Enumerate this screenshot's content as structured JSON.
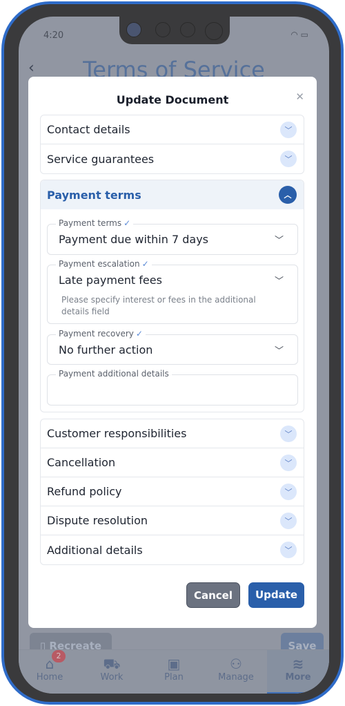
{
  "status": {
    "time": "4:20"
  },
  "background": {
    "title": "Terms of Service",
    "recreate_label": "Recreate",
    "save_label": "Save"
  },
  "nav": {
    "items": [
      {
        "label": "Home",
        "icon": "home-icon",
        "badge": "2"
      },
      {
        "label": "Work",
        "icon": "truck-icon"
      },
      {
        "label": "Plan",
        "icon": "calendar-check-icon"
      },
      {
        "label": "Manage",
        "icon": "people-icon"
      },
      {
        "label": "More",
        "icon": "layers-icon",
        "active": true
      }
    ]
  },
  "modal": {
    "title": "Update Document",
    "sections_top": [
      "Contact details",
      "Service guarantees"
    ],
    "payment": {
      "title": "Payment terms",
      "fields": [
        {
          "label": "Payment terms",
          "value": "Payment due within 7 days"
        },
        {
          "label": "Payment escalation",
          "value": "Late payment fees",
          "help": "Please specify interest or fees in the additional details field"
        },
        {
          "label": "Payment recovery",
          "value": "No further action"
        },
        {
          "label": "Payment additional details",
          "value": ""
        }
      ]
    },
    "sections_bottom": [
      "Customer responsibilities",
      "Cancellation",
      "Refund policy",
      "Dispute resolution",
      "Additional details"
    ],
    "cancel_label": "Cancel",
    "update_label": "Update"
  },
  "colors": {
    "primary": "#2a5faa",
    "cancel": "#6b7280",
    "frame": "#2f6cc9"
  }
}
